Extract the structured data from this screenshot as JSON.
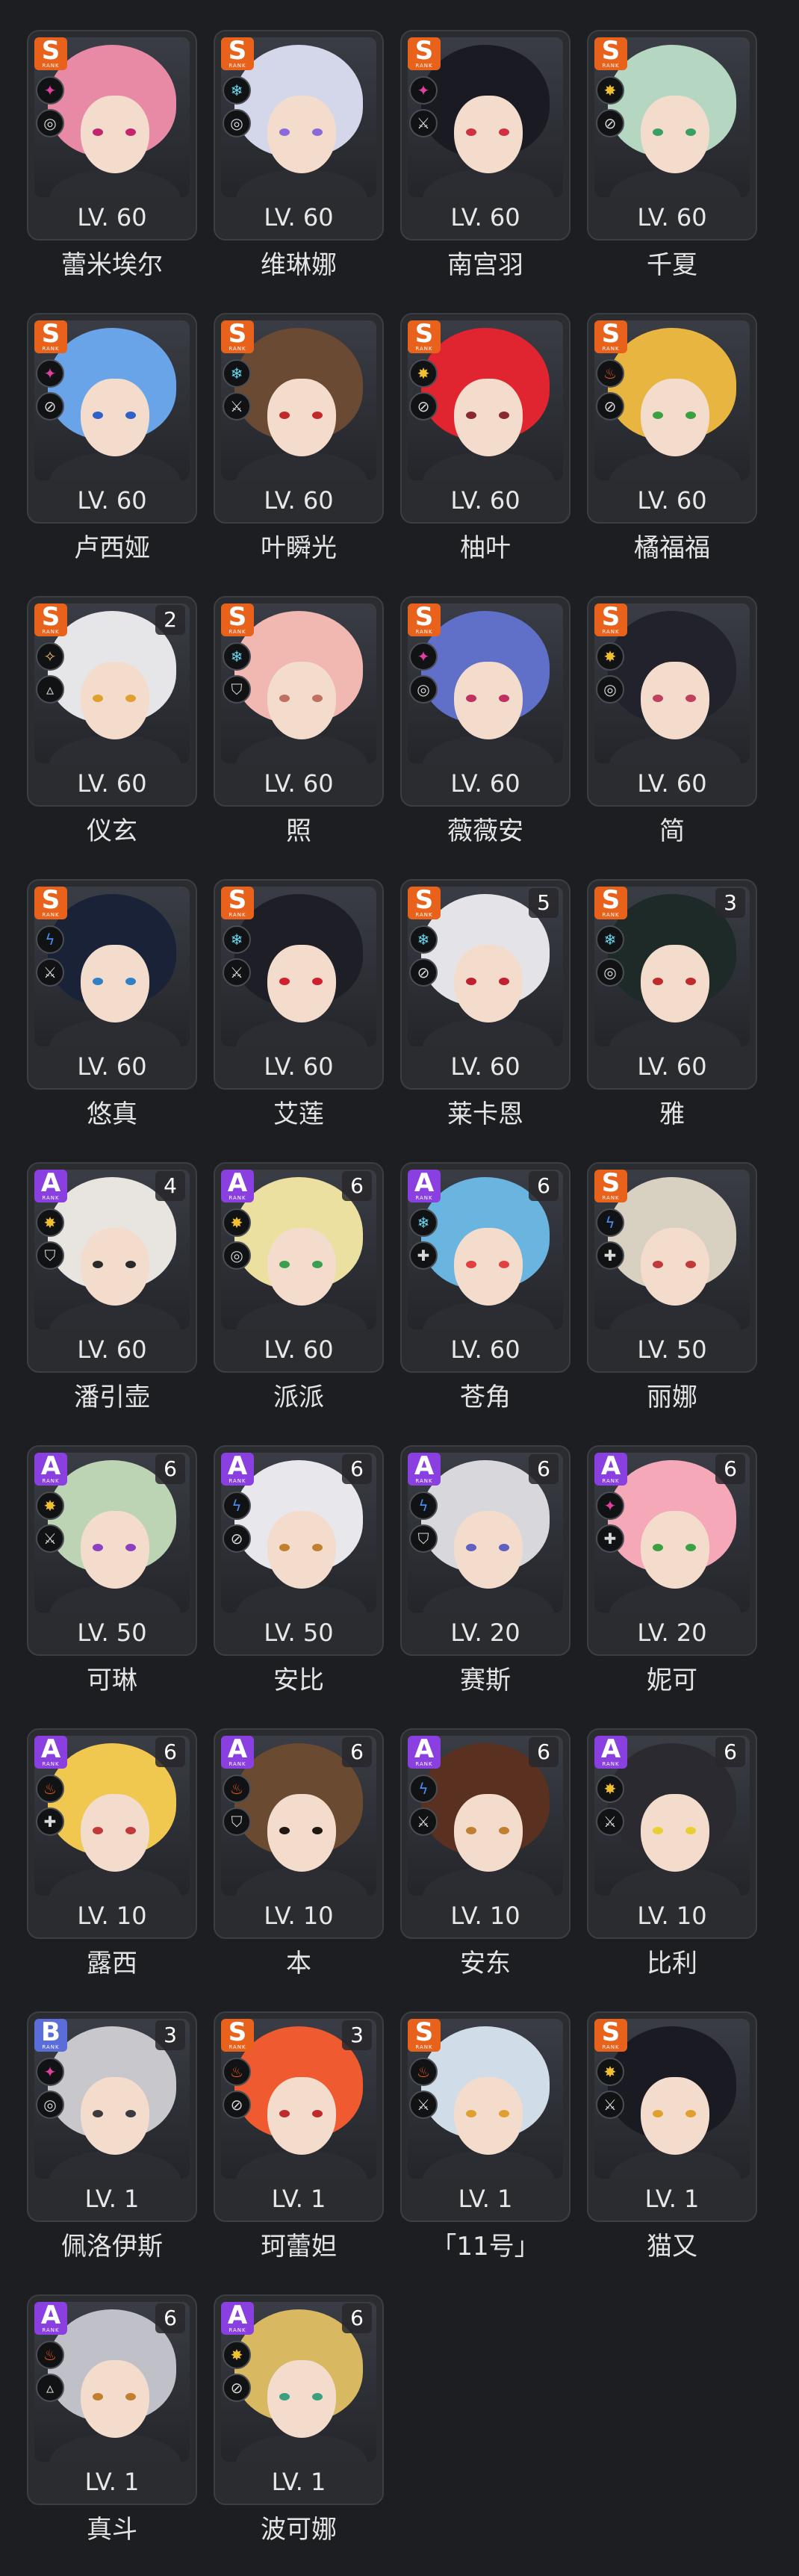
{
  "characters": [
    {
      "name": "蕾米埃尔",
      "level": "LV. 60",
      "rank": "S",
      "rank_sub": "RANK",
      "mindscape": "",
      "attribute_icon": "ether-icon",
      "specialty_icon": "anomaly-icon",
      "hair": "#e88aa6",
      "eye": "#c2266c"
    },
    {
      "name": "维琳娜",
      "level": "LV. 60",
      "rank": "S",
      "rank_sub": "RANK",
      "mindscape": "",
      "attribute_icon": "ice-icon",
      "specialty_icon": "anomaly-icon",
      "hair": "#d4d6ea",
      "eye": "#8a6ad8"
    },
    {
      "name": "南宫羽",
      "level": "LV. 60",
      "rank": "S",
      "rank_sub": "RANK",
      "mindscape": "",
      "attribute_icon": "ether-icon",
      "specialty_icon": "attack-icon",
      "hair": "#1a1a22",
      "eye": "#d03040"
    },
    {
      "name": "千夏",
      "level": "LV. 60",
      "rank": "S",
      "rank_sub": "RANK",
      "mindscape": "",
      "attribute_icon": "physical-icon",
      "specialty_icon": "stun-icon",
      "hair": "#b5d6c0",
      "eye": "#3aa060"
    },
    {
      "name": "卢西娅",
      "level": "LV. 60",
      "rank": "S",
      "rank_sub": "RANK",
      "mindscape": "",
      "attribute_icon": "ether-icon",
      "specialty_icon": "stun-icon",
      "hair": "#6aa4e8",
      "eye": "#3060c8"
    },
    {
      "name": "叶瞬光",
      "level": "LV. 60",
      "rank": "S",
      "rank_sub": "RANK",
      "mindscape": "",
      "attribute_icon": "ice-icon",
      "specialty_icon": "attack-icon",
      "hair": "#6b4a33",
      "eye": "#c02a2a"
    },
    {
      "name": "柚叶",
      "level": "LV. 60",
      "rank": "S",
      "rank_sub": "RANK",
      "mindscape": "",
      "attribute_icon": "physical-icon",
      "specialty_icon": "stun-icon",
      "hair": "#e02430",
      "eye": "#8a2a30"
    },
    {
      "name": "橘福福",
      "level": "LV. 60",
      "rank": "S",
      "rank_sub": "RANK",
      "mindscape": "",
      "attribute_icon": "fire-icon",
      "specialty_icon": "stun-icon",
      "hair": "#e8b640",
      "eye": "#3aa040"
    },
    {
      "name": "仪玄",
      "level": "LV. 60",
      "rank": "S",
      "rank_sub": "RANK",
      "mindscape": "2",
      "attribute_icon": "honed-edge-icon",
      "specialty_icon": "rupture-icon",
      "hair": "#e6e6e8",
      "eye": "#e0a030"
    },
    {
      "name": "照",
      "level": "LV. 60",
      "rank": "S",
      "rank_sub": "RANK",
      "mindscape": "",
      "attribute_icon": "ice-icon",
      "specialty_icon": "defense-icon",
      "hair": "#f0b8b0",
      "eye": "#c07060"
    },
    {
      "name": "薇薇安",
      "level": "LV. 60",
      "rank": "S",
      "rank_sub": "RANK",
      "mindscape": "",
      "attribute_icon": "ether-icon",
      "specialty_icon": "anomaly-icon",
      "hair": "#6070c8",
      "eye": "#c03060"
    },
    {
      "name": "简",
      "level": "LV. 60",
      "rank": "S",
      "rank_sub": "RANK",
      "mindscape": "",
      "attribute_icon": "physical-icon",
      "specialty_icon": "anomaly-icon",
      "hair": "#22222c",
      "eye": "#c04060"
    },
    {
      "name": "悠真",
      "level": "LV. 60",
      "rank": "S",
      "rank_sub": "RANK",
      "mindscape": "",
      "attribute_icon": "electric-icon",
      "specialty_icon": "attack-icon",
      "hair": "#1a2238",
      "eye": "#3080c8"
    },
    {
      "name": "艾莲",
      "level": "LV. 60",
      "rank": "S",
      "rank_sub": "RANK",
      "mindscape": "",
      "attribute_icon": "ice-icon",
      "specialty_icon": "attack-icon",
      "hair": "#1e1e26",
      "eye": "#d02030"
    },
    {
      "name": "莱卡恩",
      "level": "LV. 60",
      "rank": "S",
      "rank_sub": "RANK",
      "mindscape": "5",
      "attribute_icon": "ice-icon",
      "specialty_icon": "stun-icon",
      "hair": "#e4e4e8",
      "eye": "#c02030"
    },
    {
      "name": "雅",
      "level": "LV. 60",
      "rank": "S",
      "rank_sub": "RANK",
      "mindscape": "3",
      "attribute_icon": "ice-icon",
      "specialty_icon": "anomaly-icon",
      "hair": "#1e2a28",
      "eye": "#c02a2a"
    },
    {
      "name": "潘引壶",
      "level": "LV. 60",
      "rank": "A",
      "rank_sub": "RANK",
      "mindscape": "4",
      "attribute_icon": "physical-icon",
      "specialty_icon": "defense-icon",
      "hair": "#e8e4e0",
      "eye": "#2a2a2a"
    },
    {
      "name": "派派",
      "level": "LV. 60",
      "rank": "A",
      "rank_sub": "RANK",
      "mindscape": "6",
      "attribute_icon": "physical-icon",
      "specialty_icon": "anomaly-icon",
      "hair": "#ece0a0",
      "eye": "#3aa050"
    },
    {
      "name": "苍角",
      "level": "LV. 60",
      "rank": "A",
      "rank_sub": "RANK",
      "mindscape": "6",
      "attribute_icon": "ice-icon",
      "specialty_icon": "support-icon",
      "hair": "#6ab4e0",
      "eye": "#e04040"
    },
    {
      "name": "丽娜",
      "level": "LV. 50",
      "rank": "S",
      "rank_sub": "RANK",
      "mindscape": "",
      "attribute_icon": "electric-icon",
      "specialty_icon": "support-icon",
      "hair": "#d8d0c0",
      "eye": "#c03a3a"
    },
    {
      "name": "可琳",
      "level": "LV. 50",
      "rank": "A",
      "rank_sub": "RANK",
      "mindscape": "6",
      "attribute_icon": "physical-icon",
      "specialty_icon": "attack-icon",
      "hair": "#bcd4b4",
      "eye": "#8a40c0"
    },
    {
      "name": "安比",
      "level": "LV. 50",
      "rank": "A",
      "rank_sub": "RANK",
      "mindscape": "6",
      "attribute_icon": "electric-icon",
      "specialty_icon": "stun-icon",
      "hair": "#e8e8ec",
      "eye": "#c08030"
    },
    {
      "name": "赛斯",
      "level": "LV. 20",
      "rank": "A",
      "rank_sub": "RANK",
      "mindscape": "6",
      "attribute_icon": "electric-icon",
      "specialty_icon": "defense-icon",
      "hair": "#d8d8dc",
      "eye": "#6060c0"
    },
    {
      "name": "妮可",
      "level": "LV. 20",
      "rank": "A",
      "rank_sub": "RANK",
      "mindscape": "6",
      "attribute_icon": "ether-icon",
      "specialty_icon": "support-icon",
      "hair": "#f4a8b8",
      "eye": "#3aa040"
    },
    {
      "name": "露西",
      "level": "LV. 10",
      "rank": "A",
      "rank_sub": "RANK",
      "mindscape": "6",
      "attribute_icon": "fire-icon",
      "specialty_icon": "support-icon",
      "hair": "#f0c850",
      "eye": "#c03a3a"
    },
    {
      "name": "本",
      "level": "LV. 10",
      "rank": "A",
      "rank_sub": "RANK",
      "mindscape": "6",
      "attribute_icon": "fire-icon",
      "specialty_icon": "defense-icon",
      "hair": "#6a4a30",
      "eye": "#201810"
    },
    {
      "name": "安东",
      "level": "LV. 10",
      "rank": "A",
      "rank_sub": "RANK",
      "mindscape": "6",
      "attribute_icon": "electric-icon",
      "specialty_icon": "attack-icon",
      "hair": "#5a3020",
      "eye": "#c08030"
    },
    {
      "name": "比利",
      "level": "LV. 10",
      "rank": "A",
      "rank_sub": "RANK",
      "mindscape": "6",
      "attribute_icon": "physical-icon",
      "specialty_icon": "attack-icon",
      "hair": "#2a2a30",
      "eye": "#e8d030"
    },
    {
      "name": "佩洛伊斯",
      "level": "LV. 1",
      "rank": "B",
      "rank_sub": "RANK",
      "mindscape": "3",
      "attribute_icon": "ether-icon",
      "specialty_icon": "anomaly-icon",
      "hair": "#c8c8cc",
      "eye": "#3a3a40"
    },
    {
      "name": "珂蕾妲",
      "level": "LV. 1",
      "rank": "S",
      "rank_sub": "RANK",
      "mindscape": "3",
      "attribute_icon": "fire-icon",
      "specialty_icon": "stun-icon",
      "hair": "#f05a30",
      "eye": "#c02a2a"
    },
    {
      "name": "「11号」",
      "level": "LV. 1",
      "rank": "S",
      "rank_sub": "RANK",
      "mindscape": "",
      "attribute_icon": "fire-icon",
      "specialty_icon": "attack-icon",
      "hair": "#d0dce8",
      "eye": "#e0a030"
    },
    {
      "name": "猫又",
      "level": "LV. 1",
      "rank": "S",
      "rank_sub": "RANK",
      "mindscape": "",
      "attribute_icon": "physical-icon",
      "specialty_icon": "attack-icon",
      "hair": "#1a1a22",
      "eye": "#e0a030"
    },
    {
      "name": "真斗",
      "level": "LV. 1",
      "rank": "A",
      "rank_sub": "RANK",
      "mindscape": "6",
      "attribute_icon": "fire-icon",
      "specialty_icon": "rupture-icon",
      "hair": "#c0c0c8",
      "eye": "#c08030"
    },
    {
      "name": "波可娜",
      "level": "LV. 1",
      "rank": "A",
      "rank_sub": "RANK",
      "mindscape": "6",
      "attribute_icon": "physical-icon",
      "specialty_icon": "stun-icon",
      "hair": "#d8b860",
      "eye": "#3aa080"
    }
  ],
  "icons": {
    "ether-icon": {
      "glyph": "✦",
      "color": "#e040a0"
    },
    "ice-icon": {
      "glyph": "❄",
      "color": "#6ad8f0"
    },
    "physical-icon": {
      "glyph": "✸",
      "color": "#f0c030"
    },
    "fire-icon": {
      "glyph": "♨",
      "color": "#f05a20"
    },
    "electric-icon": {
      "glyph": "ϟ",
      "color": "#4a8cf0"
    },
    "honed-edge-icon": {
      "glyph": "✧",
      "color": "#f0c070"
    },
    "anomaly-icon": {
      "glyph": "◎",
      "color": "#d8d8d8"
    },
    "attack-icon": {
      "glyph": "⚔",
      "color": "#d8d8d8"
    },
    "stun-icon": {
      "glyph": "⊘",
      "color": "#d8d8d8"
    },
    "defense-icon": {
      "glyph": "⛉",
      "color": "#d8d8d8"
    },
    "support-icon": {
      "glyph": "✚",
      "color": "#d8d8d8"
    },
    "rupture-icon": {
      "glyph": "▵",
      "color": "#d8d8d8"
    }
  }
}
